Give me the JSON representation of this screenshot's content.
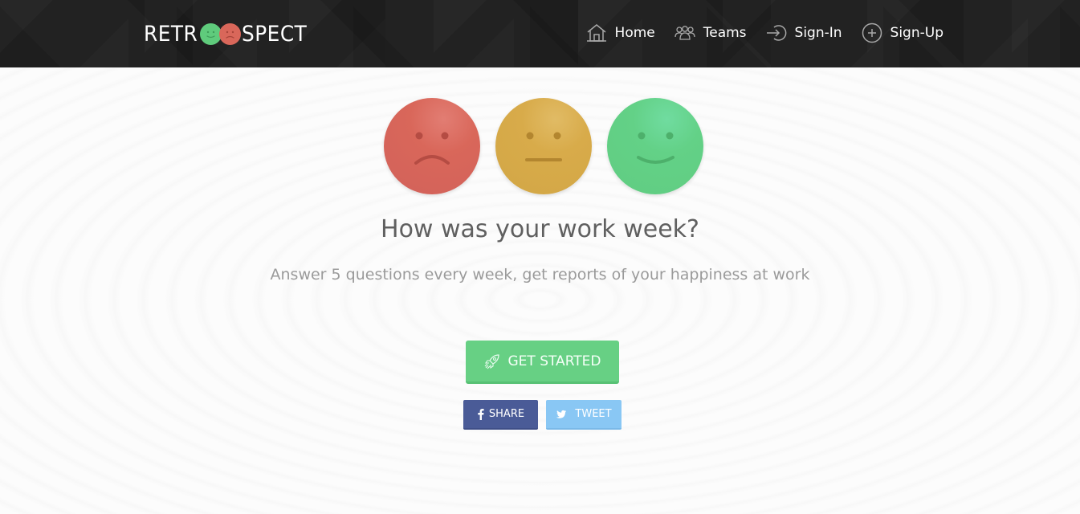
{
  "navbar": {
    "brand": {
      "prefix": "RETR",
      "suffix": "SPECT",
      "face_colors": [
        "#5fcb7c",
        "#d9675a"
      ]
    },
    "items": [
      {
        "label": "Home",
        "icon": "home-icon"
      },
      {
        "label": "Teams",
        "icon": "users-icon"
      },
      {
        "label": "Sign-In",
        "icon": "sign-in-icon"
      },
      {
        "label": "Sign-Up",
        "icon": "plus-circle-icon"
      }
    ]
  },
  "hero": {
    "faces": [
      {
        "mood": "sad",
        "color": "#d9675a"
      },
      {
        "mood": "neutral",
        "color": "#d8ab4a"
      },
      {
        "mood": "happy",
        "color": "#63d187"
      }
    ],
    "headline": "How was your work week?",
    "subline": "Answer 5 questions every week, get reports of your happiness at work",
    "cta": {
      "label": "GET STARTED",
      "icon": "rocket-icon",
      "color": "#67d084"
    },
    "share": [
      {
        "label": "SHARE",
        "icon": "facebook-icon",
        "color": "#4a5b97"
      },
      {
        "label": "TWEET",
        "icon": "twitter-icon",
        "color": "#89c7f4"
      }
    ]
  }
}
